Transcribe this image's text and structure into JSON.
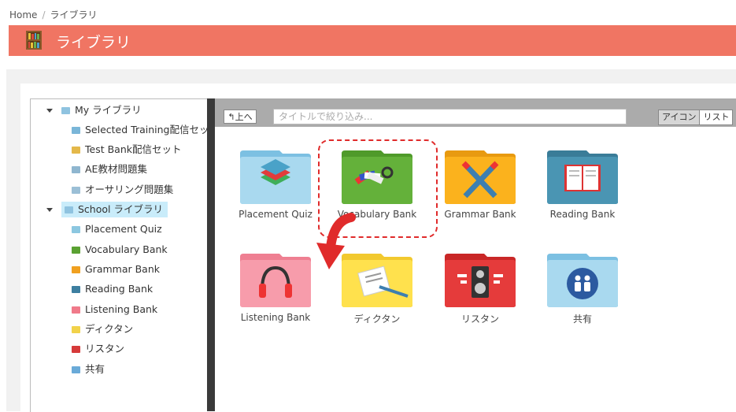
{
  "breadcrumb": {
    "home": "Home",
    "separator": "/",
    "current": "ライブラリ"
  },
  "header": {
    "title": "ライブラリ",
    "icon": "bookshelf-icon"
  },
  "tree": {
    "my_library": {
      "label": "My ライブラリ",
      "items": [
        {
          "label": "Selected Training配信セット",
          "icon_color": "#7ab6d8"
        },
        {
          "label": "Test Bank配信セット",
          "icon_color": "#e4b84a"
        },
        {
          "label": "AE教材問題集",
          "icon_color": "#8fb6cf"
        },
        {
          "label": "オーサリング問題集",
          "icon_color": "#9bbfd6"
        }
      ]
    },
    "school_library": {
      "label": "School ライブラリ",
      "items": [
        {
          "label": "Placement Quiz",
          "icon_color": "#8cc7e0"
        },
        {
          "label": "Vocabulary Bank",
          "icon_color": "#5aa132"
        },
        {
          "label": "Grammar Bank",
          "icon_color": "#f0a020"
        },
        {
          "label": "Reading Bank",
          "icon_color": "#3d7fa0"
        },
        {
          "label": "Listening Bank",
          "icon_color": "#f07a8a"
        },
        {
          "label": "ディクタン",
          "icon_color": "#f2d24a"
        },
        {
          "label": "リスタン",
          "icon_color": "#d63a3a"
        },
        {
          "label": "共有",
          "icon_color": "#6aaad8"
        }
      ]
    }
  },
  "toolbar": {
    "up_label": "上へ",
    "filter_placeholder": "タイトルで絞り込み...",
    "view_icon_label": "アイコン",
    "view_list_label": "リスト"
  },
  "folders": [
    {
      "label": "Placement Quiz",
      "icon": "layers-icon",
      "color": "#a9d9ef",
      "tab": "#7cc0e2"
    },
    {
      "label": "Vocabulary Bank",
      "icon": "color-swatch-icon",
      "color": "#64b13a",
      "tab": "#4f9a2a"
    },
    {
      "label": "Grammar Bank",
      "icon": "crossed-pencils-icon",
      "color": "#fbb21d",
      "tab": "#e89a10"
    },
    {
      "label": "Reading Bank",
      "icon": "open-book-icon",
      "color": "#4a95b3",
      "tab": "#3a7c98"
    },
    {
      "label": "Listening Bank",
      "icon": "headphones-icon",
      "color": "#f79cab",
      "tab": "#ef7f92"
    },
    {
      "label": "ディクタン",
      "icon": "paper-pencil-icon",
      "color": "#ffe14d",
      "tab": "#f2c92e"
    },
    {
      "label": "リスタン",
      "icon": "speaker-icon",
      "color": "#e53b3b",
      "tab": "#c92727"
    },
    {
      "label": "共有",
      "icon": "people-icon",
      "color": "#a9d9ef",
      "tab": "#7cc0e2"
    }
  ],
  "colors": {
    "header_bg": "#f07563",
    "highlight": "#e02b2b",
    "toolbar_bg": "#ababab"
  }
}
